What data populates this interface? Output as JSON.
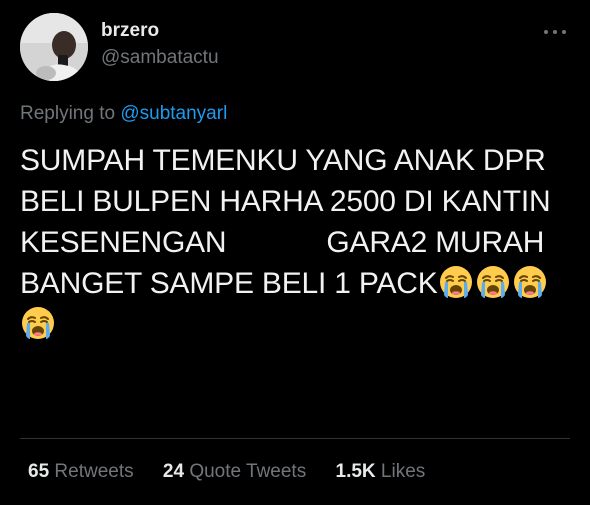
{
  "tweet": {
    "display_name": "brzero",
    "handle": "@sambatactu",
    "replying_prefix": "Replying to",
    "replying_to": "@subtanyarl",
    "text_lines": [
      "SUMPAH TEMENKU YANG ANAK DPR",
      "BELI BULPEN HARHA 2500 DI KANTIN"
    ],
    "line3_left": "KESENENGAN",
    "line3_right": "GARA2 MURAH",
    "line4": "BANGET SAMPE BELI 1 PACK",
    "emojis": [
      "loudly-crying-face",
      "loudly-crying-face",
      "loudly-crying-face",
      "loudly-crying-face"
    ]
  },
  "stats": {
    "retweets_count": "65",
    "retweets_label": "Retweets",
    "quotes_count": "24",
    "quotes_label": "Quote Tweets",
    "likes_count": "1.5K",
    "likes_label": "Likes"
  },
  "colors": {
    "background": "#000000",
    "text": "#e7e9ea",
    "secondary": "#71767b",
    "accent": "#1d9bf0",
    "divider": "#2f3336"
  }
}
